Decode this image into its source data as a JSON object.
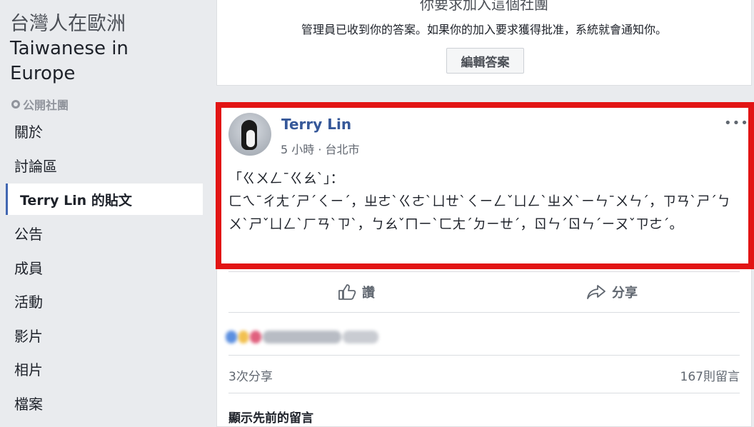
{
  "group": {
    "name_zh": "台灣人在歐洲",
    "name_en": "Taiwanese in Europe",
    "privacy": "公開社團"
  },
  "nav": {
    "items": [
      "關於",
      "討論區",
      "Terry Lin 的貼文",
      "公告",
      "成員",
      "活動",
      "影片",
      "相片",
      "檔案"
    ],
    "active_index": 2
  },
  "join_card": {
    "title_partial": "你要求加入這個社團",
    "message": "管理員已收到你的答案。如果你的加入要求獲得批准，系統就會通知你。",
    "edit_button": "編輯答案"
  },
  "post": {
    "author": "Terry Lin",
    "time": "5 小時",
    "location": "台北市",
    "text": "「ㄍㄨㄥˉㄍㄠˋ」：\nㄈㄟˉㄔㄤˊㄕˊㄑㄧˊ，ㄓㄜˋㄍㄜˋㄩㄝˋㄑㄧㄥˇㄩㄥˋㄓㄨˋㄧㄣˉㄨㄣˊ，ㄗㄢˋㄕˊㄅㄨˋㄕˇㄩㄥˋㄏㄢˋㄗˋ，ㄅㄠˇㄇㄧˋㄈㄤˊㄉㄧㄝˊ，ㄖㄣˊㄖㄣˊㄧㄡˇㄗㄜˊ。",
    "like_label": "讚",
    "share_label": "分享",
    "shares": "3次分享",
    "comments": "167則留言",
    "show_previous": "顯示先前的留言"
  },
  "colors": {
    "highlight": "#e21414",
    "link": "#365899",
    "accent": "#4267b2"
  }
}
